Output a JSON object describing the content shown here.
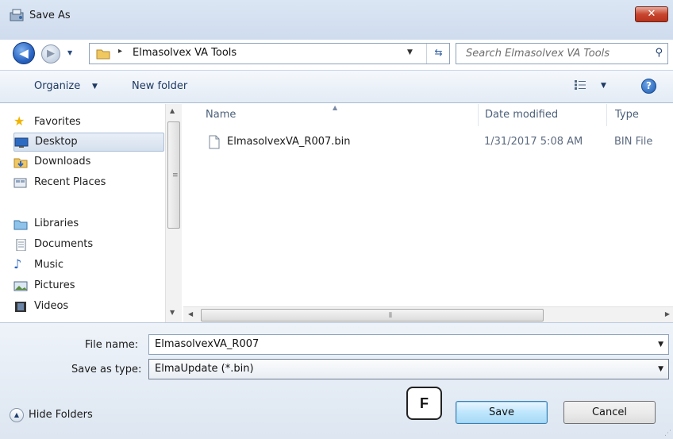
{
  "window": {
    "title": "Save As",
    "close_label": "✕"
  },
  "address": {
    "path_separator": "▸",
    "current_folder": "Elmasolvex VA Tools",
    "search_placeholder": "Search Elmasolvex VA Tools"
  },
  "toolbar": {
    "organize_label": "Organize",
    "new_folder_label": "New folder",
    "help_label": "?"
  },
  "nav": {
    "items": [
      {
        "label": "Favorites",
        "icon": "star-icon"
      },
      {
        "label": "Desktop",
        "icon": "desktop-icon",
        "selected": true
      },
      {
        "label": "Downloads",
        "icon": "downloads-icon"
      },
      {
        "label": "Recent Places",
        "icon": "recent-places-icon"
      },
      {
        "label": "Libraries",
        "icon": "libraries-icon"
      },
      {
        "label": "Documents",
        "icon": "documents-icon"
      },
      {
        "label": "Music",
        "icon": "music-icon"
      },
      {
        "label": "Pictures",
        "icon": "pictures-icon"
      },
      {
        "label": "Videos",
        "icon": "videos-icon"
      }
    ]
  },
  "filelist": {
    "columns": [
      "Name",
      "Date modified",
      "Type"
    ],
    "rows": [
      {
        "name": "ElmasolvexVA_R007.bin",
        "date": "1/31/2017 5:08 AM",
        "type": "BIN File"
      }
    ]
  },
  "form": {
    "file_name_label": "File name:",
    "file_name_value": "ElmasolvexVA_R007",
    "save_type_label": "Save as type:",
    "save_type_value": "ElmaUpdate (*.bin)"
  },
  "footer": {
    "hide_folders_label": "Hide Folders",
    "save_label": "Save",
    "cancel_label": "Cancel",
    "marker_label": "F"
  },
  "colors": {
    "accent": "#3c7fb1",
    "close": "#c8462f"
  }
}
